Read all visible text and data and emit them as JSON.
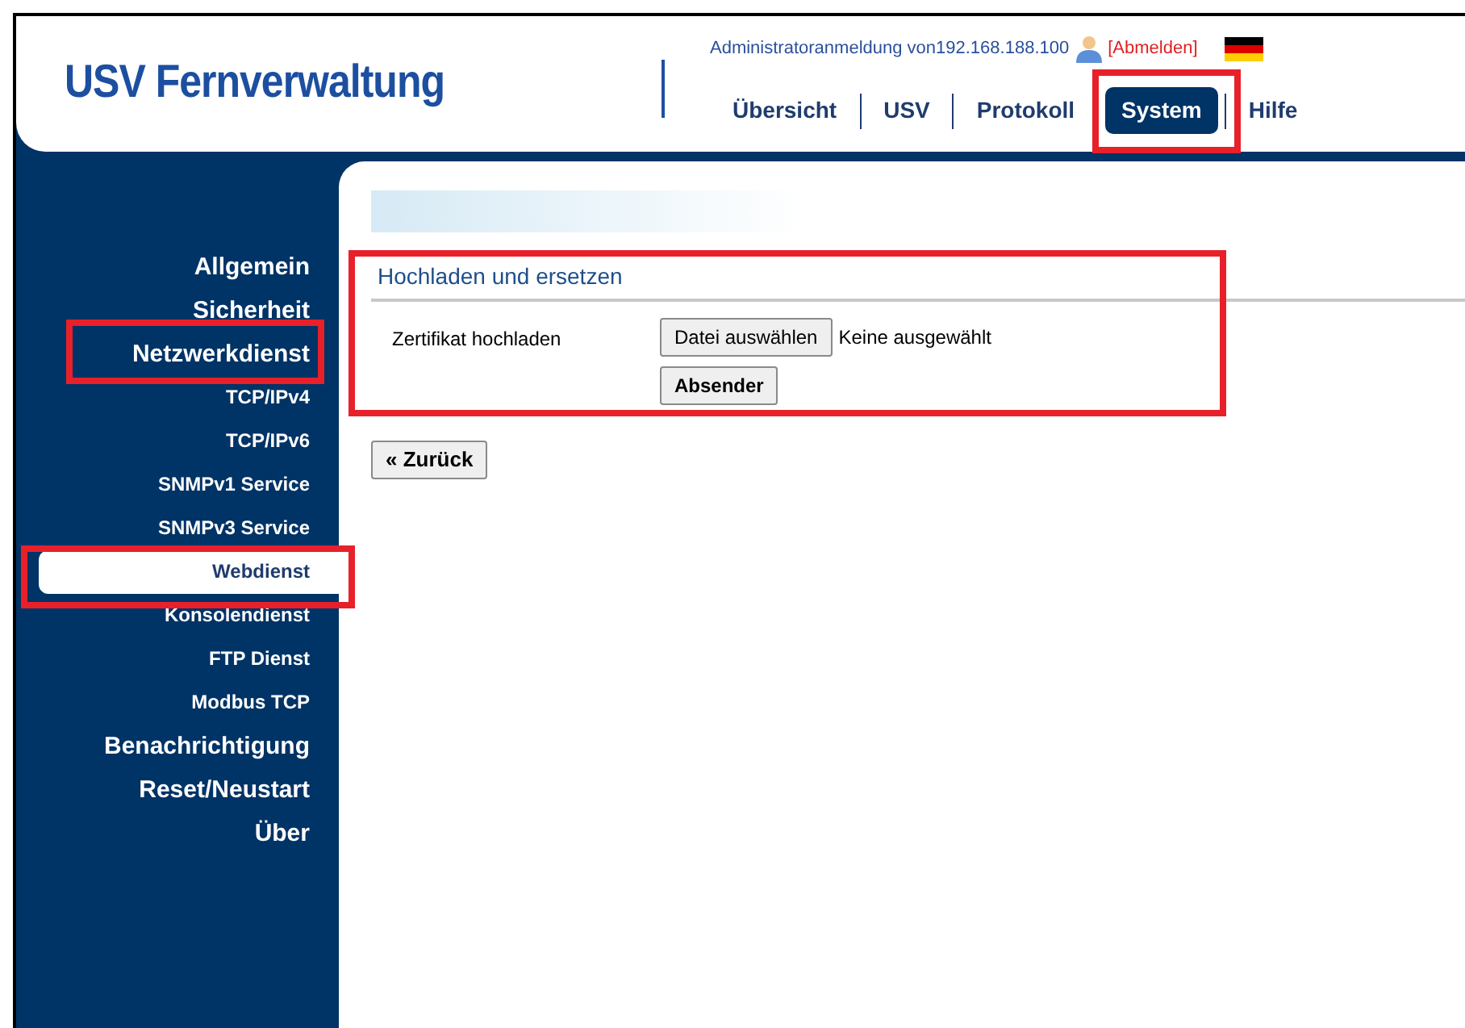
{
  "header": {
    "logo": "USV Fernverwaltung",
    "login_text": "Administratoranmeldung von192.168.188.100",
    "logout_link": "[Abmelden]"
  },
  "nav": [
    {
      "label": "Übersicht",
      "selected": false
    },
    {
      "label": "USV",
      "selected": false
    },
    {
      "label": "Protokoll",
      "selected": false
    },
    {
      "label": "System",
      "selected": true
    },
    {
      "label": "Hilfe",
      "selected": false
    }
  ],
  "sidebar": {
    "items": [
      {
        "label": "Allgemein",
        "selected": false
      },
      {
        "label": "Sicherheit",
        "selected": false
      },
      {
        "label": "Netzwerkdienst",
        "selected": false,
        "children": [
          {
            "label": "TCP/IPv4",
            "selected": false
          },
          {
            "label": "TCP/IPv6",
            "selected": false
          },
          {
            "label": "SNMPv1 Service",
            "selected": false
          },
          {
            "label": "SNMPv3 Service",
            "selected": false
          },
          {
            "label": "Webdienst",
            "selected": true
          },
          {
            "label": "Konsolendienst",
            "selected": false
          },
          {
            "label": "FTP Dienst",
            "selected": false
          },
          {
            "label": "Modbus TCP",
            "selected": false
          }
        ]
      },
      {
        "label": "Benachrichtigung",
        "selected": false
      },
      {
        "label": "Reset/Neustart",
        "selected": false
      },
      {
        "label": "Über",
        "selected": false
      }
    ]
  },
  "section": {
    "title": "Hochladen und ersetzen",
    "field_label": "Zertifikat hochladen",
    "file_button": "Datei auswählen",
    "file_status": "Keine ausgewählt",
    "submit_button": "Absender"
  },
  "back_button": "« Zurück"
}
